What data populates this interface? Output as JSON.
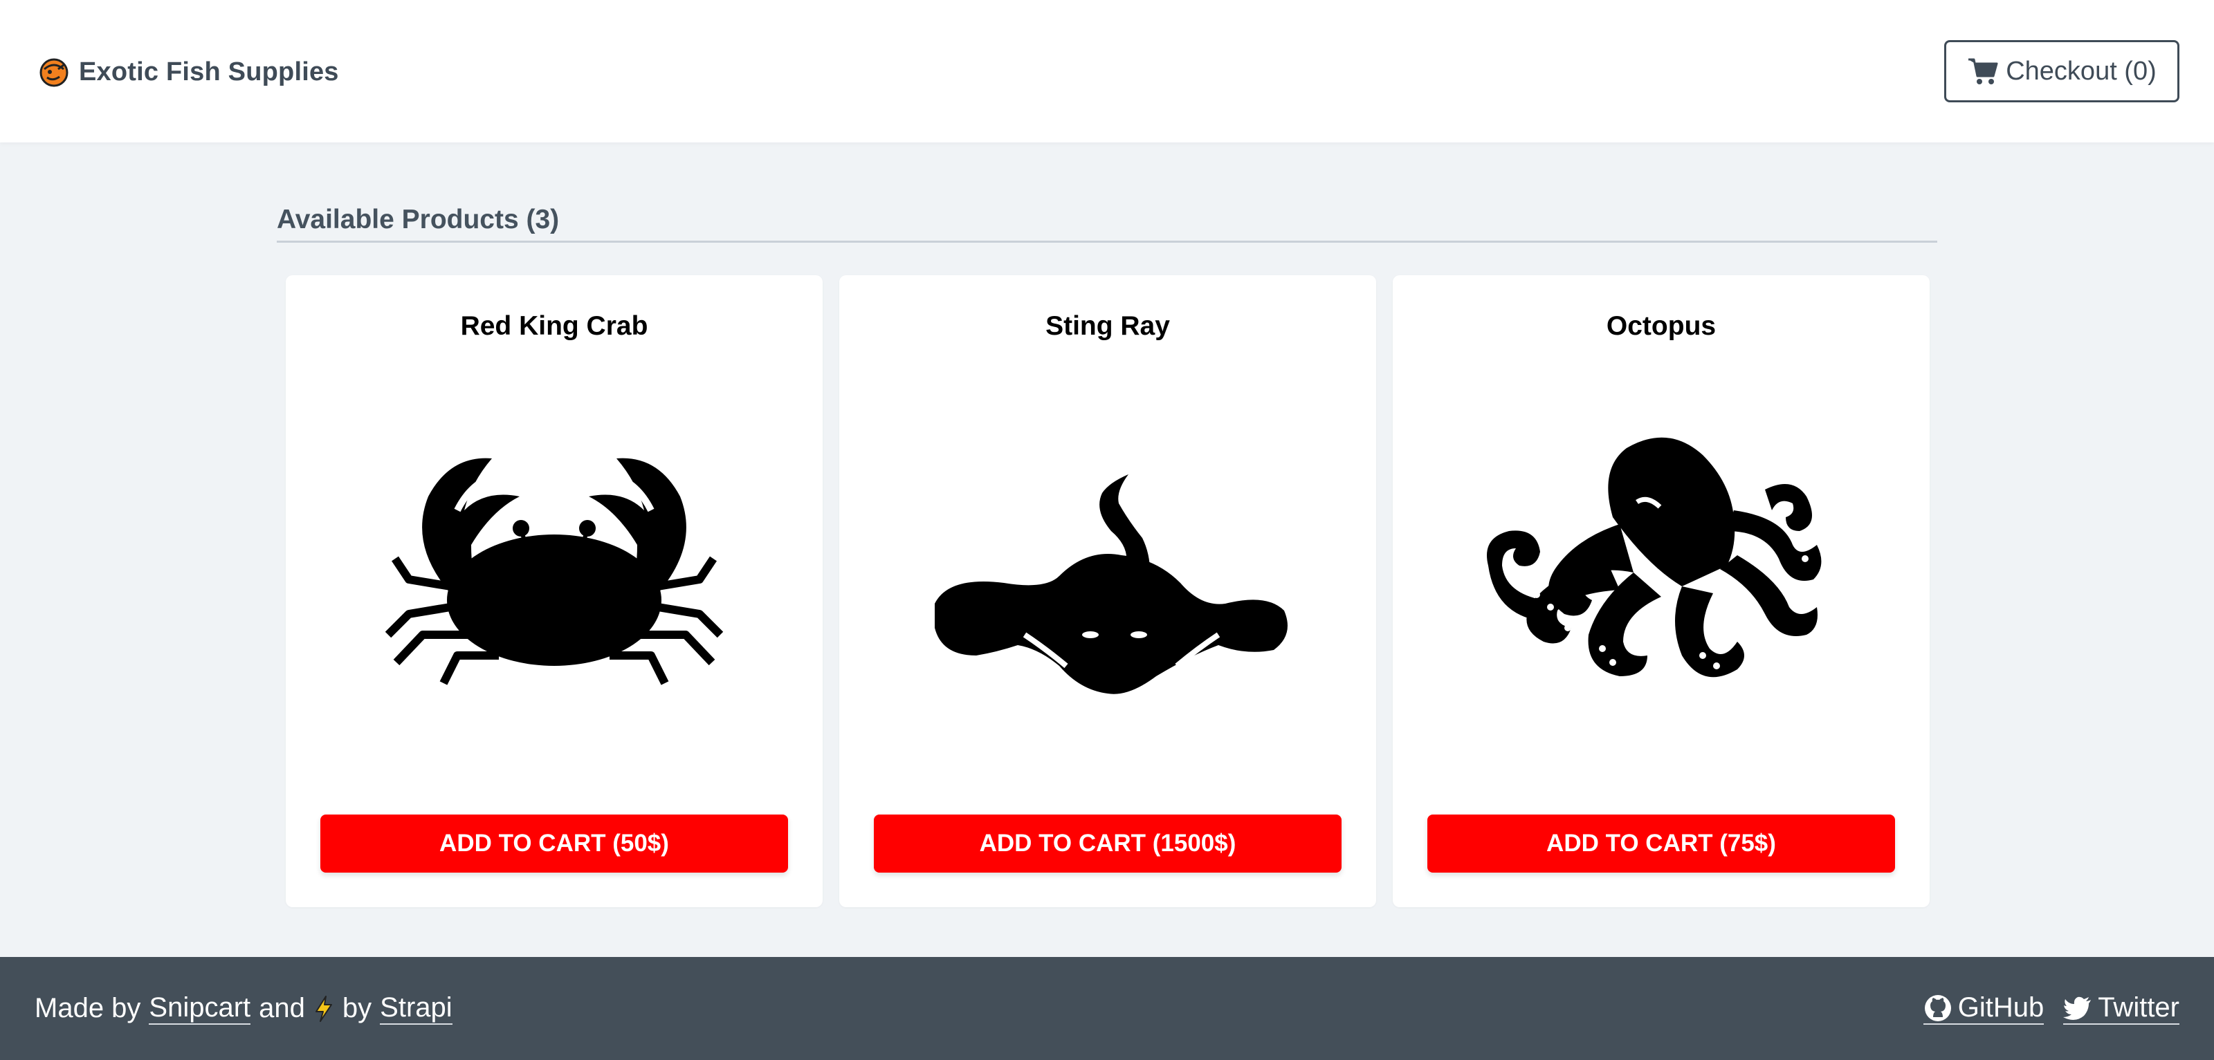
{
  "header": {
    "brand": "Exotic Fish Supplies",
    "checkout_label": "Checkout (0)"
  },
  "section": {
    "title": "Available Products (3)"
  },
  "products": [
    {
      "name": "Red King Crab",
      "button": "ADD TO CART (50$)",
      "image_icon": "crab-icon"
    },
    {
      "name": "Sting Ray",
      "button": "ADD TO CART (1500$)",
      "image_icon": "stingray-icon"
    },
    {
      "name": "Octopus",
      "button": "ADD TO CART (75$)",
      "image_icon": "octopus-icon"
    }
  ],
  "footer": {
    "made_by": "Made by",
    "snipcart": "Snipcart",
    "and": "and",
    "by": "by",
    "strapi": "Strapi",
    "github": "GitHub",
    "twitter": "Twitter"
  },
  "colors": {
    "accent": "#ff0000",
    "footer_bg": "#444f59",
    "page_bg": "#f0f3f6",
    "text_dark": "#3f4b57"
  }
}
